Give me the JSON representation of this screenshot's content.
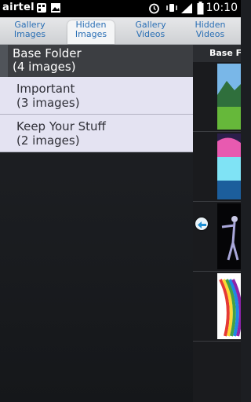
{
  "status_bar": {
    "carrier": "airtel",
    "time": "10:10",
    "icons": [
      "bbm-icon",
      "image-icon",
      "alarm-icon",
      "vibrate-icon",
      "signal-icon",
      "battery-icon"
    ]
  },
  "tabs": [
    {
      "label": "Gallery Images",
      "active": false
    },
    {
      "label": "Hidden Images",
      "active": true
    },
    {
      "label": "Gallery Videos",
      "active": false
    },
    {
      "label": "Hidden Videos",
      "active": false
    }
  ],
  "drawer": {
    "header_name": "Base Folder",
    "header_count": "(4 images)",
    "folders": [
      {
        "name": "Important",
        "count": "(3 images)"
      },
      {
        "name": "Keep Your Stuff",
        "count": "(2 images)"
      }
    ]
  },
  "content": {
    "header": "Base Folder",
    "thumbnails": [
      "landscape-thumbnail",
      "waterfall-thumbnail",
      "figure-thumbnail",
      "rainbow-thumbnail"
    ]
  },
  "colors": {
    "tab_text": "#2a6fb5",
    "folder_bg": "#e4e3f2",
    "drawer_header": "#3c3e42",
    "statusbar": "#000000"
  }
}
